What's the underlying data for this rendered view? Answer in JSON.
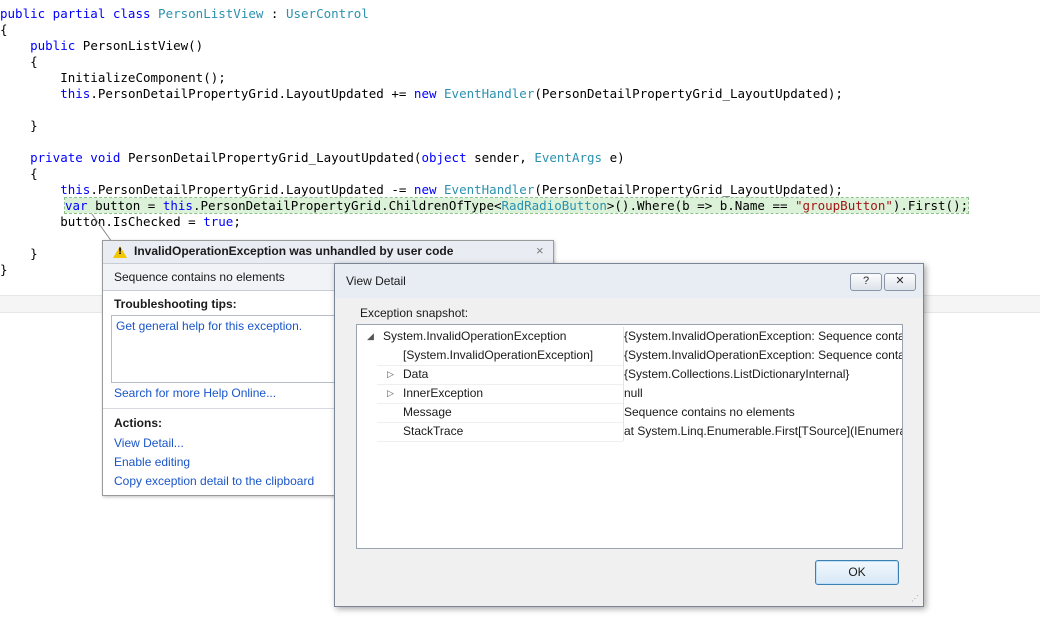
{
  "code": {
    "l1": {
      "a": "public partial class ",
      "b": "PersonListView",
      "c": " : ",
      "d": "UserControl"
    },
    "l2": "{",
    "l3": {
      "a": "    public ",
      "b": "PersonListView()"
    },
    "l4": "    {",
    "l5": "        InitializeComponent();",
    "l6": {
      "a": "        this",
      "b": ".PersonDetailPropertyGrid.LayoutUpdated += ",
      "c": "new ",
      "d": "EventHandler",
      "e": "(PersonDetailPropertyGrid_LayoutUpdated);"
    },
    "l7": "    }",
    "l8": {
      "a": "    private void ",
      "b": "PersonDetailPropertyGrid_LayoutUpdated(",
      "c": "object",
      "d": " sender, ",
      "e": "EventArgs",
      "f": " e)"
    },
    "l9": "    {",
    "l10": {
      "a": "        this",
      "b": ".PersonDetailPropertyGrid.LayoutUpdated -= ",
      "c": "new ",
      "d": "EventHandler",
      "e": "(PersonDetailPropertyGrid_LayoutUpdated);"
    },
    "l11": {
      "a": "var",
      "b": " button = ",
      "c": "this",
      "d": ".PersonDetailPropertyGrid.ChildrenOfType<",
      "e": "RadRadioButton",
      "f": ">().Where(b => b.Name == ",
      "g": "\"groupButton\"",
      "h": ").First();"
    },
    "l12": {
      "a": "        button.IsChecked = ",
      "b": "true",
      "c": ";"
    },
    "l13": "    }",
    "l14": "}"
  },
  "assistant": {
    "title": "InvalidOperationException was unhandled by user code",
    "close": "×",
    "message": "Sequence contains no elements",
    "tips_heading": "Troubleshooting tips:",
    "tip_link": "Get general help for this exception.",
    "search_link": "Search for more Help Online...",
    "actions_heading": "Actions:",
    "actions": [
      "View Detail...",
      "Enable editing",
      "Copy exception detail to the clipboard"
    ]
  },
  "dialog": {
    "title": "View Detail",
    "help_btn": "?",
    "close_btn": "✕",
    "snapshot_label": "Exception snapshot:",
    "rows": [
      {
        "name": "System.InvalidOperationException",
        "value": "{System.InvalidOperationException: Sequence contai",
        "expander": "◢"
      },
      {
        "name": "[System.InvalidOperationException]",
        "value": "{System.InvalidOperationException: Sequence contai",
        "expander": ""
      },
      {
        "name": "Data",
        "value": "{System.Collections.ListDictionaryInternal}",
        "expander": "▷"
      },
      {
        "name": "InnerException",
        "value": "null",
        "expander": "▷"
      },
      {
        "name": "Message",
        "value": "Sequence contains no elements",
        "expander": ""
      },
      {
        "name": "StackTrace",
        "value": "   at System.Linq.Enumerable.First[TSource](IEnumera",
        "expander": ""
      }
    ],
    "ok": "OK"
  },
  "colors": {
    "keyword": "#0000ff",
    "type": "#2b91af",
    "string": "#a31515",
    "highlight": "#dbf2d9",
    "link": "#1a56c8"
  }
}
